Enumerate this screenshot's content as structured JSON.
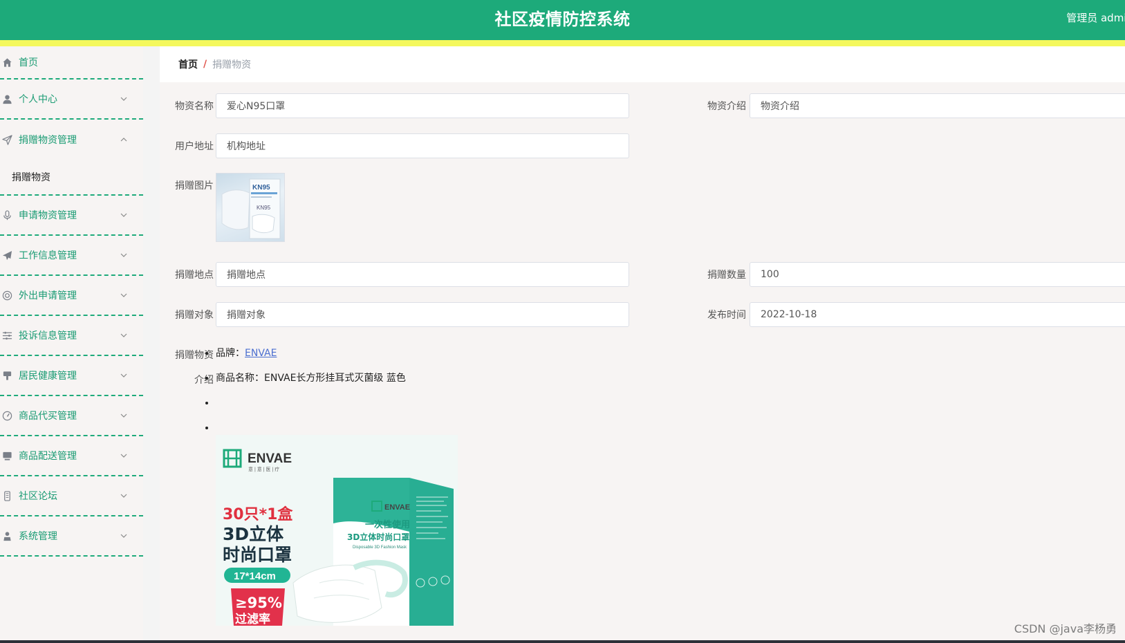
{
  "app": {
    "title": "社区疫情防控系统",
    "user": "管理员 admin"
  },
  "sidebar": {
    "items": [
      {
        "label": "首页",
        "icon": "home-icon",
        "expandable": false
      },
      {
        "label": "个人中心",
        "icon": "user-icon",
        "expandable": true,
        "expanded": false
      },
      {
        "label": "捐赠物资管理",
        "icon": "send-icon",
        "expandable": true,
        "expanded": true
      },
      {
        "label": "申请物资管理",
        "icon": "microphone-icon",
        "expandable": true,
        "expanded": false
      },
      {
        "label": "工作信息管理",
        "icon": "paper-plane-icon",
        "expandable": true,
        "expanded": false
      },
      {
        "label": "外出申请管理",
        "icon": "lifebuoy-icon",
        "expandable": true,
        "expanded": false
      },
      {
        "label": "投诉信息管理",
        "icon": "sliders-icon",
        "expandable": true,
        "expanded": false
      },
      {
        "label": "居民健康管理",
        "icon": "brush-icon",
        "expandable": true,
        "expanded": false
      },
      {
        "label": "商品代买管理",
        "icon": "gauge-icon",
        "expandable": true,
        "expanded": false
      },
      {
        "label": "商品配送管理",
        "icon": "monitor-icon",
        "expandable": true,
        "expanded": false
      },
      {
        "label": "社区论坛",
        "icon": "phone-icon",
        "expandable": true,
        "expanded": false
      },
      {
        "label": "系统管理",
        "icon": "person-icon",
        "expandable": true,
        "expanded": false
      }
    ],
    "submenu": {
      "label": "捐赠物资"
    }
  },
  "breadcrumb": {
    "home": "首页",
    "separator": "/",
    "current": "捐赠物资"
  },
  "form": {
    "name_label": "物资名称",
    "name_value": "爱心N95口罩",
    "intro_label": "物资介绍",
    "intro_value": "物资介绍",
    "address_label": "用户地址",
    "address_value": "机构地址",
    "image_label": "捐赠图片",
    "place_label": "捐赠地点",
    "place_value": "捐赠地点",
    "qty_label": "捐赠数量",
    "qty_value": "100",
    "target_label": "捐赠对象",
    "target_value": "捐赠对象",
    "time_label": "发布时间",
    "time_value": "2022-10-18",
    "desc_label_1": "捐赠物资",
    "desc_label_2": "介绍"
  },
  "description": {
    "brand_prefix": "品牌：",
    "brand": "ENVAE",
    "product_name": "商品名称：ENVAE长方形挂耳式灭菌级 蓝色"
  },
  "thumbnail": {
    "box_text": "KN95",
    "box_text_2": "KN95"
  },
  "product_image": {
    "brand": "ENVAE",
    "brand_sub": "意 | 意 | 医 | 疗",
    "headline_1": "30只*1盒",
    "headline_2": "3D立体",
    "headline_3": "时尚口罩",
    "size": "17*14cm",
    "filter_1": "≥95%",
    "filter_2": "过滤率",
    "box_line_1": "一次性使用",
    "box_line_2": "3D立体时尚口罩",
    "box_line_3": "Disposable 3D Fashion Mask",
    "box_brand": "ENVAE"
  },
  "watermark": "CSDN @java李杨勇",
  "colors": {
    "header": "#1daa7a",
    "stripe": "#f4f85d",
    "accent": "#1a9b73"
  }
}
